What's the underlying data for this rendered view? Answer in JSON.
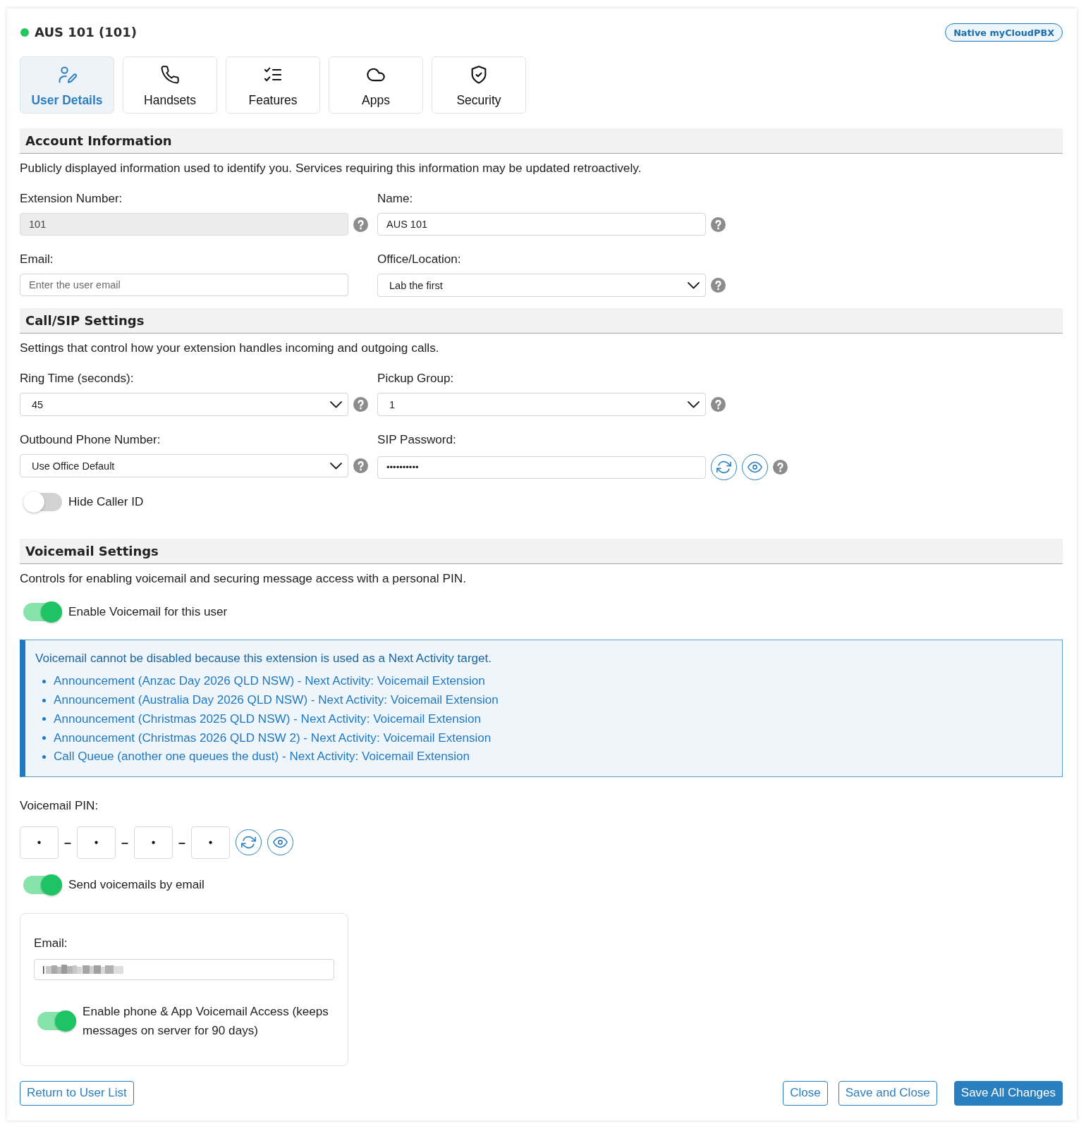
{
  "header": {
    "title": "AUS 101 (101)",
    "online": true,
    "badge": "Native myCloudPBX"
  },
  "tabs": [
    {
      "label": "User Details",
      "selected": true
    },
    {
      "label": "Handsets",
      "selected": false
    },
    {
      "label": "Features",
      "selected": false
    },
    {
      "label": "Apps",
      "selected": false
    },
    {
      "label": "Security",
      "selected": false
    }
  ],
  "account_information": {
    "heading": "Account Information",
    "description": "Publicly displayed information used to identify you. Services requiring this information may be updated retroactively.",
    "fields": [
      {
        "kind": "text",
        "label": "Extension Number:",
        "value": "101",
        "disabled": true,
        "help": true
      },
      {
        "kind": "text",
        "label": "Name:",
        "value": "AUS 101",
        "disabled": false,
        "help": true
      },
      {
        "kind": "text",
        "label": "Email:",
        "placeholder": "Enter the user email",
        "disabled": false,
        "help": false
      },
      {
        "kind": "select",
        "label": "Office/Location:",
        "value": "Lab the first",
        "disabled": false,
        "help": true
      }
    ]
  },
  "call_sip_settings": {
    "heading": "Call/SIP Settings",
    "description": "Settings that control how your extension handles incoming and outgoing calls.",
    "fields": [
      {
        "kind": "select",
        "label": "Ring Time (seconds):",
        "value": "45",
        "disabled": false,
        "help": true
      },
      {
        "kind": "select",
        "label": "Pickup Group:",
        "value": "1",
        "disabled": false,
        "help": true
      },
      {
        "kind": "select",
        "label": "Outbound Phone Number:",
        "value": "Use Office Default",
        "disabled": false,
        "help": true
      },
      {
        "kind": "password",
        "label": "SIP Password:",
        "value": "••••••••••",
        "disabled": false,
        "help": true
      }
    ],
    "toggle": {
      "label": "Hide Caller ID",
      "on": false
    }
  },
  "voicemail_settings": {
    "heading": "Voicemail Settings",
    "description": "Controls for enabling voicemail and securing message access with a personal PIN.",
    "toggle": {
      "label": "Enable Voicemail for this user",
      "on": true
    },
    "notice": {
      "title": "Voicemail cannot be disabled because this extension is used as a Next Activity target.",
      "items": [
        "Announcement (Anzac Day 2026 QLD NSW) - Next Activity: Voicemail Extension",
        "Announcement (Australia Day 2026 QLD NSW) - Next Activity: Voicemail Extension",
        "Announcement (Christmas 2025 QLD NSW) - Next Activity: Voicemail Extension",
        "Announcement (Christmas 2026 QLD NSW 2) - Next Activity: Voicemail Extension",
        "Call Queue (another one queues the dust) - Next Activity: Voicemail Extension"
      ]
    },
    "pin": {
      "label": "Voicemail PIN:",
      "digits": [
        "•",
        "•",
        "•",
        "•"
      ],
      "separator": "–"
    },
    "email_toggle": {
      "label": "Send voicemails by email",
      "on": true
    },
    "email_panel": {
      "label": "Email:",
      "redacted": true,
      "toggle": {
        "label": "Enable phone & App Voicemail Access (keeps messages on server for 90 days)",
        "on": true
      }
    }
  },
  "footer": {
    "left_buttons": [
      {
        "label": "Return to User List",
        "primary": false
      }
    ],
    "right_buttons": [
      {
        "label": "Close",
        "primary": false
      },
      {
        "label": "Save and Close",
        "primary": false
      },
      {
        "label": "Save All Changes",
        "primary": true
      }
    ]
  }
}
